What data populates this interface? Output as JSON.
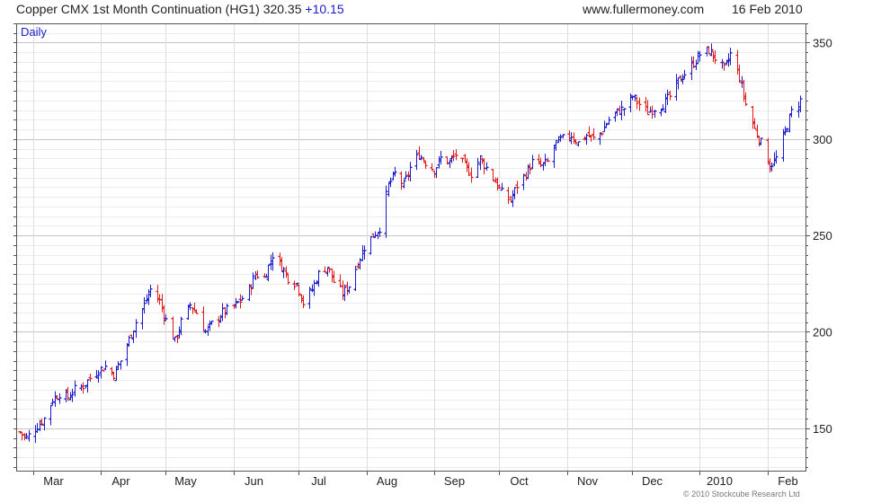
{
  "header": {
    "instrument": "Copper CMX 1st Month Continuation (HG1)",
    "last_price": "320.35",
    "change": "+10.15",
    "website": "www.fullermoney.com",
    "date": "16 Feb 2010"
  },
  "footer": {
    "credit": "© 2010 Stockcube Research Ltd"
  },
  "colors": {
    "up": "#1a1acc",
    "down": "#e01818",
    "grid": "#cccccc",
    "frame": "#555555"
  },
  "chart_data": {
    "type": "ohlc-bar",
    "period_label": "Daily",
    "x_axis": {
      "start": "2009-02-23",
      "end": "2010-02-16",
      "month_labels": [
        {
          "label": "Mar",
          "date": "2009-03-01"
        },
        {
          "label": "Apr",
          "date": "2009-04-01"
        },
        {
          "label": "May",
          "date": "2009-05-01"
        },
        {
          "label": "Jun",
          "date": "2009-06-01"
        },
        {
          "label": "Jul",
          "date": "2009-07-01"
        },
        {
          "label": "Aug",
          "date": "2009-08-01"
        },
        {
          "label": "Sep",
          "date": "2009-09-01"
        },
        {
          "label": "Oct",
          "date": "2009-10-01"
        },
        {
          "label": "Nov",
          "date": "2009-11-01"
        },
        {
          "label": "Dec",
          "date": "2009-12-01"
        },
        {
          "label": "2010",
          "date": "2010-01-01"
        },
        {
          "label": "Feb",
          "date": "2010-02-01"
        }
      ]
    },
    "y_axis": {
      "ylim": [
        128,
        360
      ],
      "ticks": [
        150,
        200,
        250,
        300,
        350
      ],
      "minor_step": 5,
      "side": "right"
    },
    "grid": true,
    "close_path": [
      [
        "2009-02-23",
        148
      ],
      [
        "2009-02-26",
        145
      ],
      [
        "2009-03-02",
        150
      ],
      [
        "2009-03-06",
        155
      ],
      [
        "2009-03-10",
        165
      ],
      [
        "2009-03-13",
        168
      ],
      [
        "2009-03-17",
        166
      ],
      [
        "2009-03-20",
        170
      ],
      [
        "2009-03-24",
        172
      ],
      [
        "2009-03-27",
        176
      ],
      [
        "2009-03-31",
        180
      ],
      [
        "2009-04-03",
        182
      ],
      [
        "2009-04-07",
        178
      ],
      [
        "2009-04-10",
        185
      ],
      [
        "2009-04-14",
        196
      ],
      [
        "2009-04-17",
        205
      ],
      [
        "2009-04-21",
        214
      ],
      [
        "2009-04-24",
        222
      ],
      [
        "2009-04-28",
        216
      ],
      [
        "2009-05-01",
        206
      ],
      [
        "2009-05-05",
        195
      ],
      [
        "2009-05-08",
        205
      ],
      [
        "2009-05-12",
        214
      ],
      [
        "2009-05-15",
        210
      ],
      [
        "2009-05-19",
        200
      ],
      [
        "2009-05-22",
        204
      ],
      [
        "2009-05-27",
        210
      ],
      [
        "2009-06-01",
        213
      ],
      [
        "2009-06-04",
        216
      ],
      [
        "2009-06-08",
        222
      ],
      [
        "2009-06-11",
        230
      ],
      [
        "2009-06-15",
        228
      ],
      [
        "2009-06-19",
        240
      ],
      [
        "2009-06-23",
        234
      ],
      [
        "2009-06-26",
        228
      ],
      [
        "2009-06-30",
        225
      ],
      [
        "2009-07-03",
        215
      ],
      [
        "2009-07-07",
        222
      ],
      [
        "2009-07-10",
        230
      ],
      [
        "2009-07-14",
        234
      ],
      [
        "2009-07-17",
        226
      ],
      [
        "2009-07-21",
        220
      ],
      [
        "2009-07-24",
        224
      ],
      [
        "2009-07-28",
        236
      ],
      [
        "2009-07-31",
        244
      ],
      [
        "2009-08-04",
        250
      ],
      [
        "2009-08-07",
        254
      ],
      [
        "2009-08-11",
        276
      ],
      [
        "2009-08-14",
        282
      ],
      [
        "2009-08-18",
        276
      ],
      [
        "2009-08-21",
        285
      ],
      [
        "2009-08-25",
        292
      ],
      [
        "2009-08-28",
        288
      ],
      [
        "2009-09-01",
        284
      ],
      [
        "2009-09-04",
        290
      ],
      [
        "2009-09-08",
        288
      ],
      [
        "2009-09-11",
        292
      ],
      [
        "2009-09-15",
        286
      ],
      [
        "2009-09-18",
        282
      ],
      [
        "2009-09-22",
        290
      ],
      [
        "2009-09-25",
        285
      ],
      [
        "2009-09-29",
        278
      ],
      [
        "2009-10-02",
        272
      ],
      [
        "2009-10-06",
        268
      ],
      [
        "2009-10-09",
        276
      ],
      [
        "2009-10-13",
        282
      ],
      [
        "2009-10-16",
        288
      ],
      [
        "2009-10-20",
        286
      ],
      [
        "2009-10-23",
        288
      ],
      [
        "2009-10-27",
        298
      ],
      [
        "2009-10-30",
        300
      ],
      [
        "2009-11-03",
        302
      ],
      [
        "2009-11-06",
        298
      ],
      [
        "2009-11-10",
        302
      ],
      [
        "2009-11-13",
        300
      ],
      [
        "2009-11-17",
        304
      ],
      [
        "2009-11-20",
        310
      ],
      [
        "2009-11-24",
        314
      ],
      [
        "2009-11-27",
        316
      ],
      [
        "2009-12-01",
        322
      ],
      [
        "2009-12-04",
        318
      ],
      [
        "2009-12-08",
        314
      ],
      [
        "2009-12-11",
        316
      ],
      [
        "2009-12-15",
        318
      ],
      [
        "2009-12-18",
        322
      ],
      [
        "2009-12-22",
        330
      ],
      [
        "2009-12-28",
        338
      ],
      [
        "2010-01-01",
        344
      ],
      [
        "2010-01-05",
        346
      ],
      [
        "2010-01-08",
        342
      ],
      [
        "2010-01-12",
        336
      ],
      [
        "2010-01-15",
        344
      ],
      [
        "2010-01-19",
        332
      ],
      [
        "2010-01-22",
        318
      ],
      [
        "2010-01-26",
        305
      ],
      [
        "2010-01-29",
        298
      ],
      [
        "2010-02-02",
        286
      ],
      [
        "2010-02-05",
        290
      ],
      [
        "2010-02-09",
        304
      ],
      [
        "2010-02-12",
        314
      ],
      [
        "2010-02-16",
        320
      ]
    ]
  }
}
